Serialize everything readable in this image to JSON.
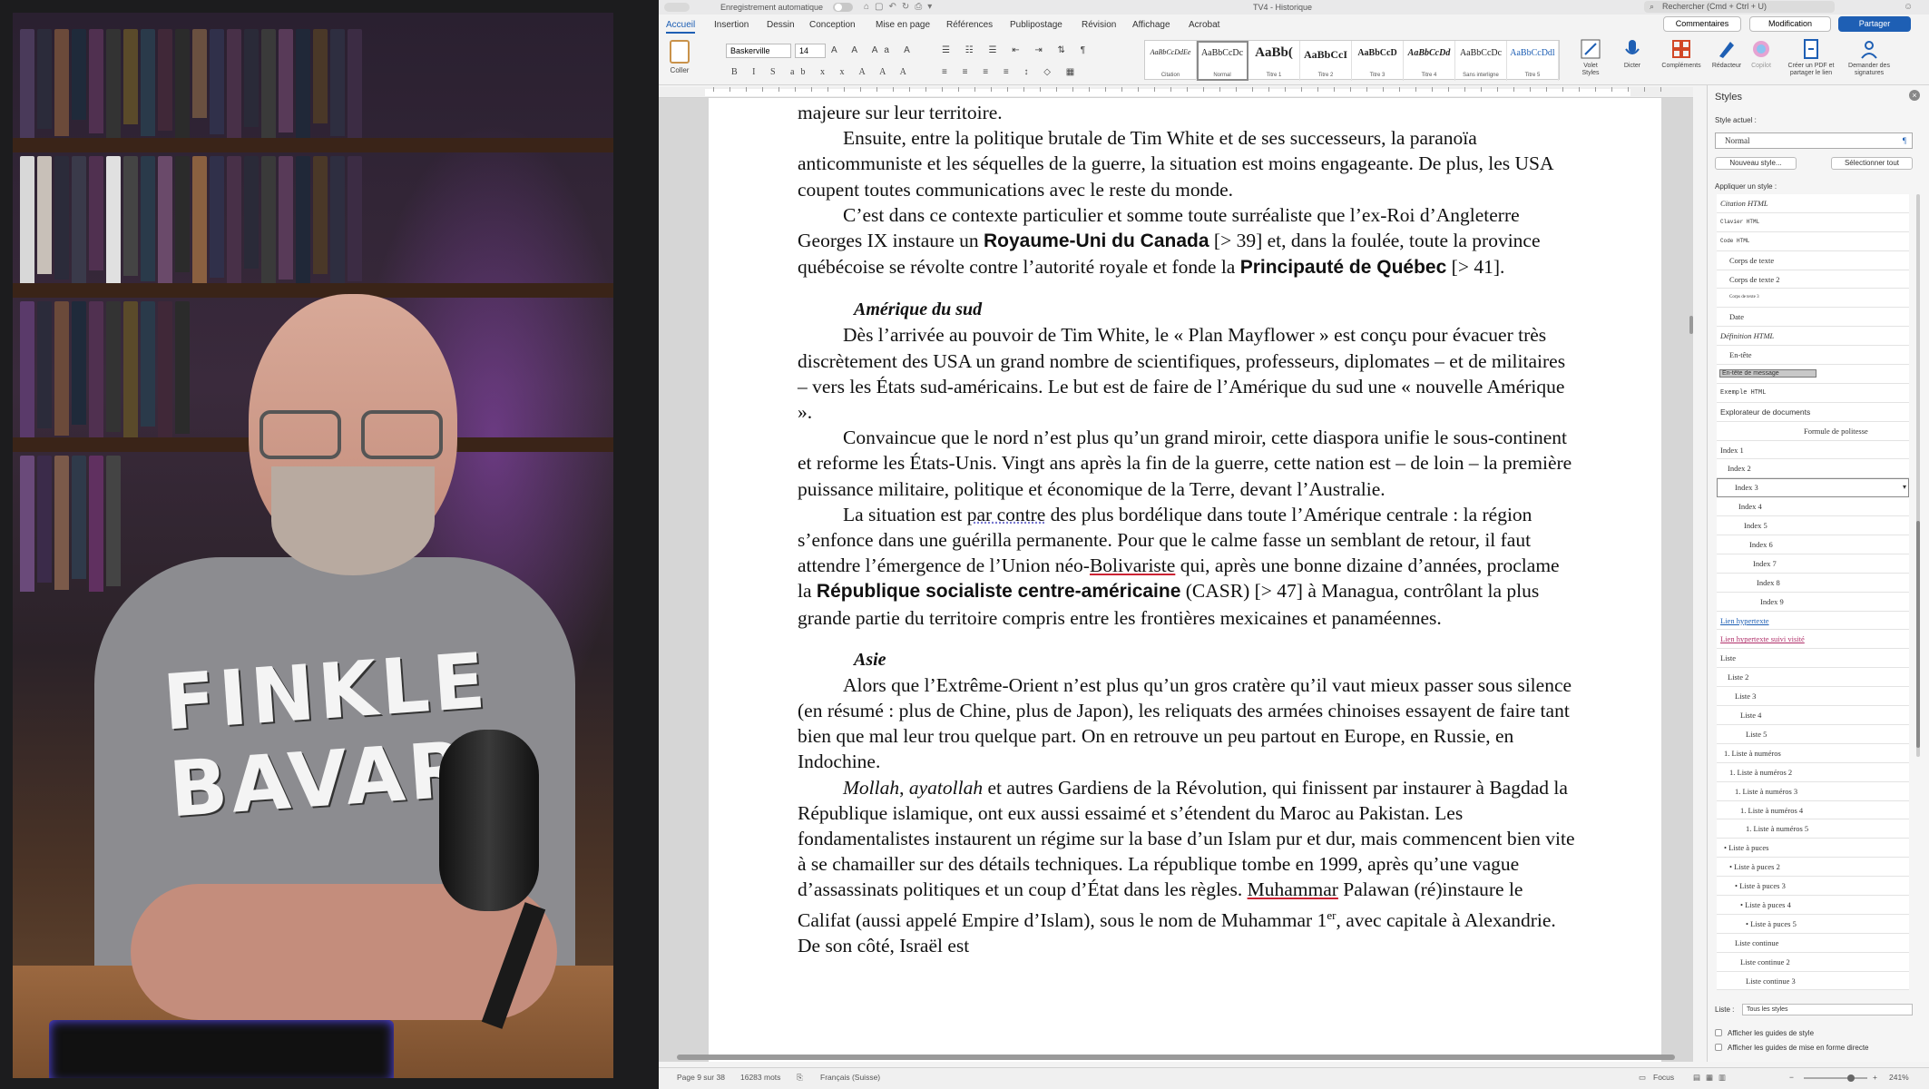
{
  "app": {
    "autosave_label": "Enregistrement automatique",
    "doc_title": "TV4 - Historique",
    "search_placeholder": "Rechercher (Cmd + Ctrl + U)"
  },
  "tabs": [
    "Accueil",
    "Insertion",
    "Dessin",
    "Conception",
    "Mise en page",
    "Références",
    "Publipostage",
    "Révision",
    "Affichage",
    "Acrobat"
  ],
  "header_buttons": {
    "comments": "Commentaires",
    "modification": "Modification",
    "share": "Partager"
  },
  "ribbon": {
    "paste_label": "Coller",
    "font_name": "Baskerville",
    "font_size": "14",
    "style_gallery": [
      {
        "sample": "AaBbCcDdEe",
        "name": "Citation"
      },
      {
        "sample": "AaBbCcDc",
        "name": "Normal"
      },
      {
        "sample": "AaBb(",
        "name": "Titre 1"
      },
      {
        "sample": "AaBbCcI",
        "name": "Titre 2"
      },
      {
        "sample": "AaBbCcD",
        "name": "Titre 3"
      },
      {
        "sample": "AaBbCcDd",
        "name": "Titre 4"
      },
      {
        "sample": "AaBbCcDc",
        "name": "Sans interligne"
      },
      {
        "sample": "AaBbCcDdl",
        "name": "Titre 5"
      }
    ],
    "styles_pane_label": "Volet Styles",
    "dictate_label": "Dicter",
    "addins_label": "Compléments",
    "editor_label": "Rédacteur",
    "copilot_label": "Copilot",
    "pdf_label": "Créer un PDF et partager le lien",
    "signature_label": "Demander des signatures"
  },
  "document": {
    "p0": "majeure sur leur territoire.",
    "p1": "Ensuite, entre la politique brutale de Tim White et de ses successeurs, la paranoïa anticommuniste et les séquelles de la guerre, la situation est moins engageante. De plus, les USA coupent toutes communications avec le reste du monde.",
    "p2_a": "C’est dans ce contexte particulier et somme toute surréaliste que l’ex-Roi d’Angleterre Georges IX instaure un ",
    "p2_b1": "Royaume-Uni du Canada",
    "p2_c": " [> 39] et, dans la foulée, toute la province québécoise se révolte contre l’autorité royale et fonde la ",
    "p2_b2": "Principauté de Québec",
    "p2_d": " [> 41].",
    "h_amerique": "Amérique du sud",
    "p3": "Dès l’arrivée au pouvoir de Tim White, le « Plan Mayflower » est conçu pour évacuer très discrètement des USA un grand nombre de scientifiques, professeurs, diplomates – et de militaires – vers les États sud-américains. Le but est de faire de l’Amérique du sud une « nouvelle Amérique ».",
    "p4": "Convaincue que le nord n’est plus qu’un grand miroir, cette diaspora unifie le sous-continent et reforme les États-Unis. Vingt ans après la fin de la guerre, cette nation est – de loin – la première puissance militaire, politique et économique de la Terre, devant l’Australie.",
    "p5_a": "La situation est ",
    "p5_u1": "par contre",
    "p5_b": " des plus bordélique dans toute l’Amérique centrale : la région s’enfonce dans une guérilla permanente. Pour que le calme fasse un semblant de retour, il faut attendre l’émergence de l’Union néo-",
    "p5_u2": "Bolivariste",
    "p5_c": " qui, après une bonne dizaine d’années, proclame la ",
    "p5_bold": "République socialiste centre-américaine",
    "p5_d": " (CASR) [> 47] à Managua, contrôlant la plus grande partie du territoire compris entre les frontières mexicaines et panaméennes.",
    "h_asie": "Asie",
    "p6": "Alors que l’Extrême-Orient n’est plus qu’un gros cratère qu’il vaut mieux passer sous silence (en résumé : plus de Chine, plus de Japon), les reliquats des armées chinoises essayent de faire tant bien que mal leur trou quelque part. On en retrouve un peu partout en Europe, en Russie, en Indochine.",
    "p7_i1": "Mollah",
    "p7_sep": ", ",
    "p7_i2": "ayatollah",
    "p7_a": " et autres Gardiens de la Révolution, qui finissent par instaurer à Bagdad la République islamique, ont eux aussi essaimé et s’étendent du Maroc au Pakistan. Les fondamentalistes instaurent un régime sur la base d’un Islam pur et dur, mais commencent bien vite à se chamailler sur des détails techniques. La république tombe en 1999, après qu’une vague d’assassinats politiques et un coup d’État dans les règles. ",
    "p7_u": "Muhammar",
    "p7_b": " Palawan (ré)instaure le Califat (aussi appelé Empire d’Islam), sous le nom de Muhammar 1",
    "p7_sup": "er",
    "p7_c": ", avec capitale à Alexandrie. De son côté, Israël est"
  },
  "styles_pane": {
    "title": "Styles",
    "current_label": "Style actuel :",
    "current_value": "Normal",
    "new_style": "Nouveau style...",
    "select_all": "Sélectionner tout",
    "apply_label": "Appliquer un style :",
    "items": [
      "Citation HTML",
      "Clavier HTML",
      "Code HTML",
      "Corps de texte",
      "Corps de texte 2",
      "Corps de texte 3",
      "Date",
      "Définition HTML",
      "En-tête",
      "En-tête de message",
      "Exemple HTML",
      "Explorateur de documents",
      "Formule de politesse",
      "Index 1",
      "Index 2",
      "Index 3",
      "Index 4",
      "Index 5",
      "Index 6",
      "Index 7",
      "Index 8",
      "Index 9",
      "Lien hypertexte",
      "Lien hypertexte suivi visité",
      "Liste",
      "Liste 2",
      "Liste 3",
      "Liste 4",
      "Liste 5",
      "1. Liste à numéros",
      "1. Liste à numéros 2",
      "1. Liste à numéros 3",
      "1. Liste à numéros 4",
      "1. Liste à numéros 5",
      "• Liste à puces",
      "• Liste à puces 2",
      "• Liste à puces 3",
      "• Liste à puces 4",
      "• Liste à puces 5",
      "Liste continue",
      "Liste continue 2",
      "Liste continue 3"
    ],
    "list_label": "Liste :",
    "list_value": "Tous les styles",
    "show_guides": "Afficher les guides de style",
    "show_direct": "Afficher les guides de mise en forme directe"
  },
  "statusbar": {
    "page": "Page 9 sur 38",
    "words": "16283 mots",
    "language": "Français (Suisse)",
    "focus": "Focus",
    "zoom": "241%"
  },
  "webcam": {
    "shirt_text": "FINKLE BAVARD"
  },
  "colors": {
    "accent": "#1e5fb4",
    "page": "#ffffff",
    "workspace": "#d6d6d6"
  }
}
